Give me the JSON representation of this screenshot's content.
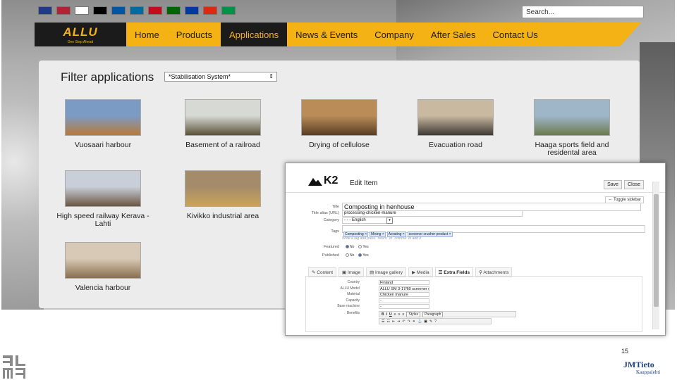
{
  "site": {
    "flags": [
      {
        "icon": "uk-flag-icon",
        "color": "#1f3a8a"
      },
      {
        "icon": "us-flag-icon",
        "color": "#b22234"
      },
      {
        "icon": "finland-flag-icon",
        "color": "#ffffff"
      },
      {
        "icon": "germany-flag-icon",
        "color": "#000000"
      },
      {
        "icon": "france-flag-icon",
        "color": "#0055a4"
      },
      {
        "icon": "sweden-flag-icon",
        "color": "#006aa7"
      },
      {
        "icon": "spain-flag-icon",
        "color": "#c60b1e"
      },
      {
        "icon": "portugal-flag-icon",
        "color": "#006600"
      },
      {
        "icon": "russia-flag-icon",
        "color": "#0039a6"
      },
      {
        "icon": "china-flag-icon",
        "color": "#de2910"
      },
      {
        "icon": "italy-flag-icon",
        "color": "#009246"
      }
    ],
    "search_placeholder": "Search...",
    "logo": {
      "mark": "ALLU",
      "tagline": "One Step Ahead"
    },
    "nav": [
      "Home",
      "Products",
      "Applications",
      "News & Events",
      "Company",
      "After Sales",
      "Contact Us"
    ],
    "nav_active": "Applications",
    "filter_title": "Filter applications",
    "filter_value": "*Stabilisation System*",
    "applications": [
      {
        "label": "Vuosaari harbour",
        "colors": [
          "#7b9bc4",
          "#b87a3a"
        ]
      },
      {
        "label": "Basement of a railroad",
        "colors": [
          "#d6d9d4",
          "#5c5238"
        ]
      },
      {
        "label": "Drying of cellulose",
        "colors": [
          "#b98c58",
          "#5a3d25"
        ]
      },
      {
        "label": "Evacuation road",
        "colors": [
          "#c9b9a0",
          "#3e3a35"
        ]
      },
      {
        "label": "Haaga sports field and residental area",
        "colors": [
          "#9fb6c9",
          "#6c7a4e"
        ]
      },
      {
        "label": "High speed railway Kerava - Lahti",
        "colors": [
          "#c8cfd8",
          "#6a5642"
        ]
      },
      {
        "label": "Kivikko industrial area",
        "colors": [
          "#a48c6a",
          "#caa45a"
        ]
      },
      {
        "label": "Valencia harbour",
        "colors": [
          "#d8c9b6",
          "#8a6e4e"
        ]
      }
    ],
    "brand_color": "#f5b214"
  },
  "k2": {
    "logo": "K2",
    "title": "Edit Item",
    "buttons": [
      "Save",
      "Close"
    ],
    "toggle_sidebar": "Toggle sidebar",
    "labels": {
      "title": "Title",
      "alias": "Title alias (URL)",
      "category": "Category",
      "tags": "Tags",
      "featured": "Featured",
      "published": "Published"
    },
    "title_value": "Composting in henhouse",
    "alias_value": "processing-chicken-manure",
    "category_value": "- - - English",
    "tags": [
      "Composting ×",
      "Mixing ×",
      "Aerating ×",
      "screener crusher product ×"
    ],
    "tags_hint": "Write a tag and press \"return\" or \"comma\" to add it",
    "radio_no": "No",
    "radio_yes": "Yes",
    "tabs": [
      "Content",
      "Image",
      "Image gallery",
      "Media",
      "Extra Fields",
      "Attachments"
    ],
    "tab_active": "Extra Fields",
    "extra_fields": [
      {
        "label": "Country",
        "value": "Finland"
      },
      {
        "label": "ALLU Model",
        "value": "ALLU SM 3-17/60 screener crusher"
      },
      {
        "label": "Material",
        "value": "Chicken manure"
      },
      {
        "label": "Capacity",
        "value": "-"
      },
      {
        "label": "Base machine",
        "value": "-"
      }
    ],
    "benefits_label": "Benefits",
    "editor": {
      "styles": "Styles",
      "format": "Paragraph"
    }
  },
  "footer": {
    "page_number": "15",
    "company": "JMTieto",
    "company_sub": "Kauppalehti",
    "left_logo": "alma-logo"
  }
}
